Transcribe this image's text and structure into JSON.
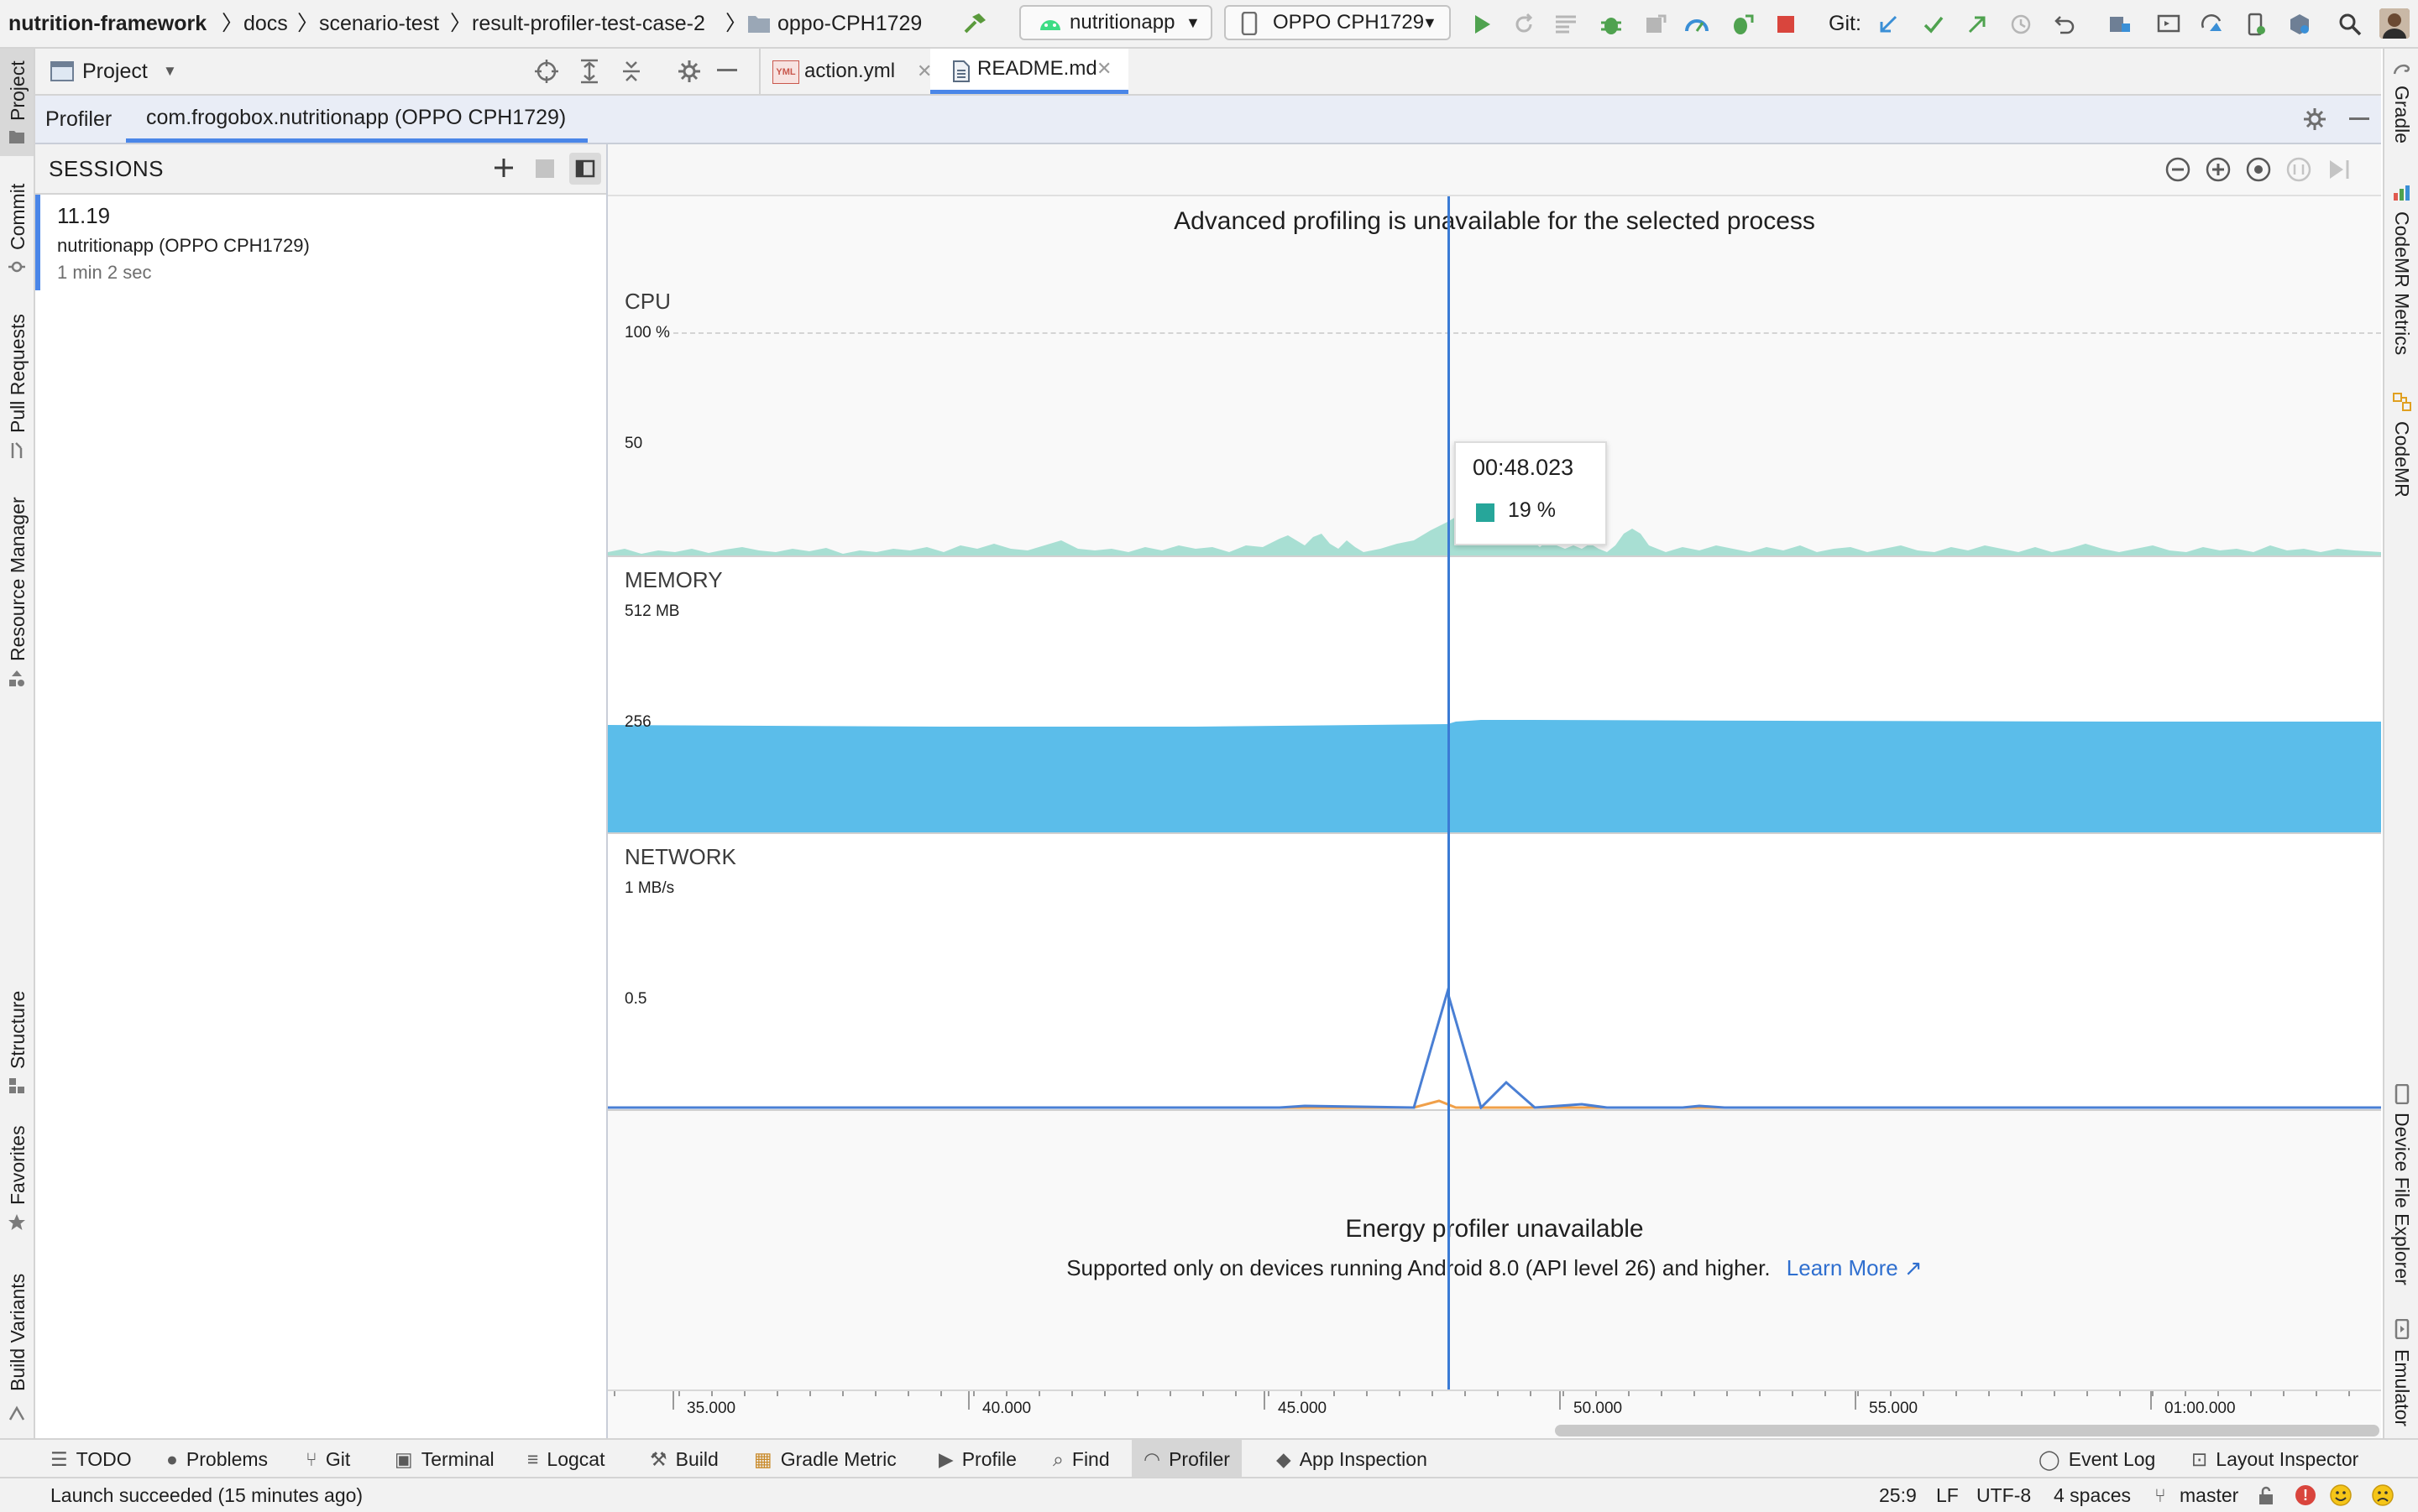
{
  "navbar": {
    "breadcrumbs": [
      "nutrition-framework",
      "docs",
      "scenario-test",
      "result-profiler-test-case-2",
      "oppo-CPH1729"
    ],
    "run_config": "nutritionapp",
    "device": "OPPO CPH1729",
    "git_label": "Git:",
    "icons": [
      "hammer-icon",
      "run-icon",
      "rerun-icon",
      "coverage-icon",
      "debug-icon",
      "attach-debugger-icon",
      "profile-icon",
      "apply-changes-icon",
      "stop-icon",
      "git-update-icon",
      "git-commit-icon",
      "git-push-icon",
      "history-icon",
      "rollback-icon",
      "project-structure-icon",
      "avd-manager-icon",
      "sync-icon",
      "device-manager-icon",
      "sdk-manager-icon",
      "search-icon",
      "avatar"
    ]
  },
  "left_stripe": [
    "Project",
    "Commit",
    "Pull Requests",
    "Resource Manager",
    "Structure",
    "Favorites",
    "Build Variants"
  ],
  "right_stripe": [
    "Gradle",
    "CodeMR Metrics",
    "CodeMR",
    "Device File Explorer",
    "Emulator"
  ],
  "project_panel": {
    "title": "Project"
  },
  "editor_tabs": [
    {
      "label": "action.yml",
      "icon": "yml-file-icon",
      "badge": "YML"
    },
    {
      "label": "README.md",
      "icon": "markdown-file-icon"
    }
  ],
  "tool_window": {
    "tabs": [
      "Profiler",
      "com.frogobox.nutritionapp (OPPO CPH1729)"
    ],
    "active_tab": 1
  },
  "sessions": {
    "title": "SESSIONS",
    "items": [
      {
        "time": "11.19",
        "name": "nutritionapp (OPPO CPH1729)",
        "duration": "1 min 2 sec"
      }
    ]
  },
  "profiler": {
    "banner": "Advanced profiling is unavailable for the selected process",
    "cpu": {
      "label": "CPU",
      "max": "100 %",
      "mid": "50"
    },
    "memory": {
      "label": "MEMORY",
      "max": "512 MB",
      "mid": "256"
    },
    "network": {
      "label": "NETWORK",
      "max": "1 MB/s",
      "mid": "0.5"
    },
    "tooltip": {
      "time": "00:48.023",
      "value": "19 %",
      "color": "#26a69a"
    },
    "energy": {
      "title": "Energy profiler unavailable",
      "message": "Supported only on devices running Android 8.0 (API level 26) and higher.",
      "link": "Learn More ↗"
    },
    "time_ticks": [
      "35.000",
      "40.000",
      "45.000",
      "50.000",
      "55.000",
      "01:00.000"
    ],
    "colors": {
      "cpu": "#a8dfd3",
      "memory": "#5bbdea",
      "network_rx": "#4a7fd4",
      "network_tx": "#f0a04a",
      "cursor": "#3a7bd5"
    }
  },
  "bottom_tabs": [
    "TODO",
    "Problems",
    "Git",
    "Terminal",
    "Logcat",
    "Build",
    "Gradle Metric",
    "Profile",
    "Find",
    "Profiler",
    "App Inspection",
    "Event Log",
    "Layout Inspector"
  ],
  "status": {
    "message": "Launch succeeded (15 minutes ago)",
    "position": "25:9",
    "line_sep": "LF",
    "encoding": "UTF-8",
    "indent": "4 spaces",
    "branch": "master"
  }
}
